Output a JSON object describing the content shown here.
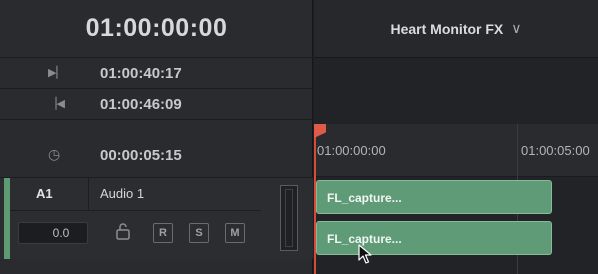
{
  "left_panel": {
    "timecode": "01:00:00:00",
    "rows": [
      {
        "icon": "mark-in-icon",
        "glyph": "▶▏",
        "value": "01:00:40:17"
      },
      {
        "icon": "mark-out-icon",
        "glyph": "▕◀",
        "value": "01:00:46:09"
      },
      {
        "icon": "clock-icon",
        "glyph": "◷",
        "value": "00:00:05:15"
      }
    ]
  },
  "track": {
    "id": "A1",
    "name": "Audio 1",
    "volume": "0.0",
    "lock_glyph": "🔓",
    "buttons": [
      "R",
      "S",
      "M"
    ],
    "accent_color": "#5e9a72"
  },
  "timeline": {
    "title": "Heart Monitor FX",
    "dropdown_glyph": "∨",
    "ruler_labels": [
      "01:00:00:00",
      "01:00:05:00"
    ],
    "clips": [
      "FL_capture...",
      "FL_capture..."
    ],
    "clip_color": "#5e9b76",
    "playhead_color": "#d94a3a"
  }
}
